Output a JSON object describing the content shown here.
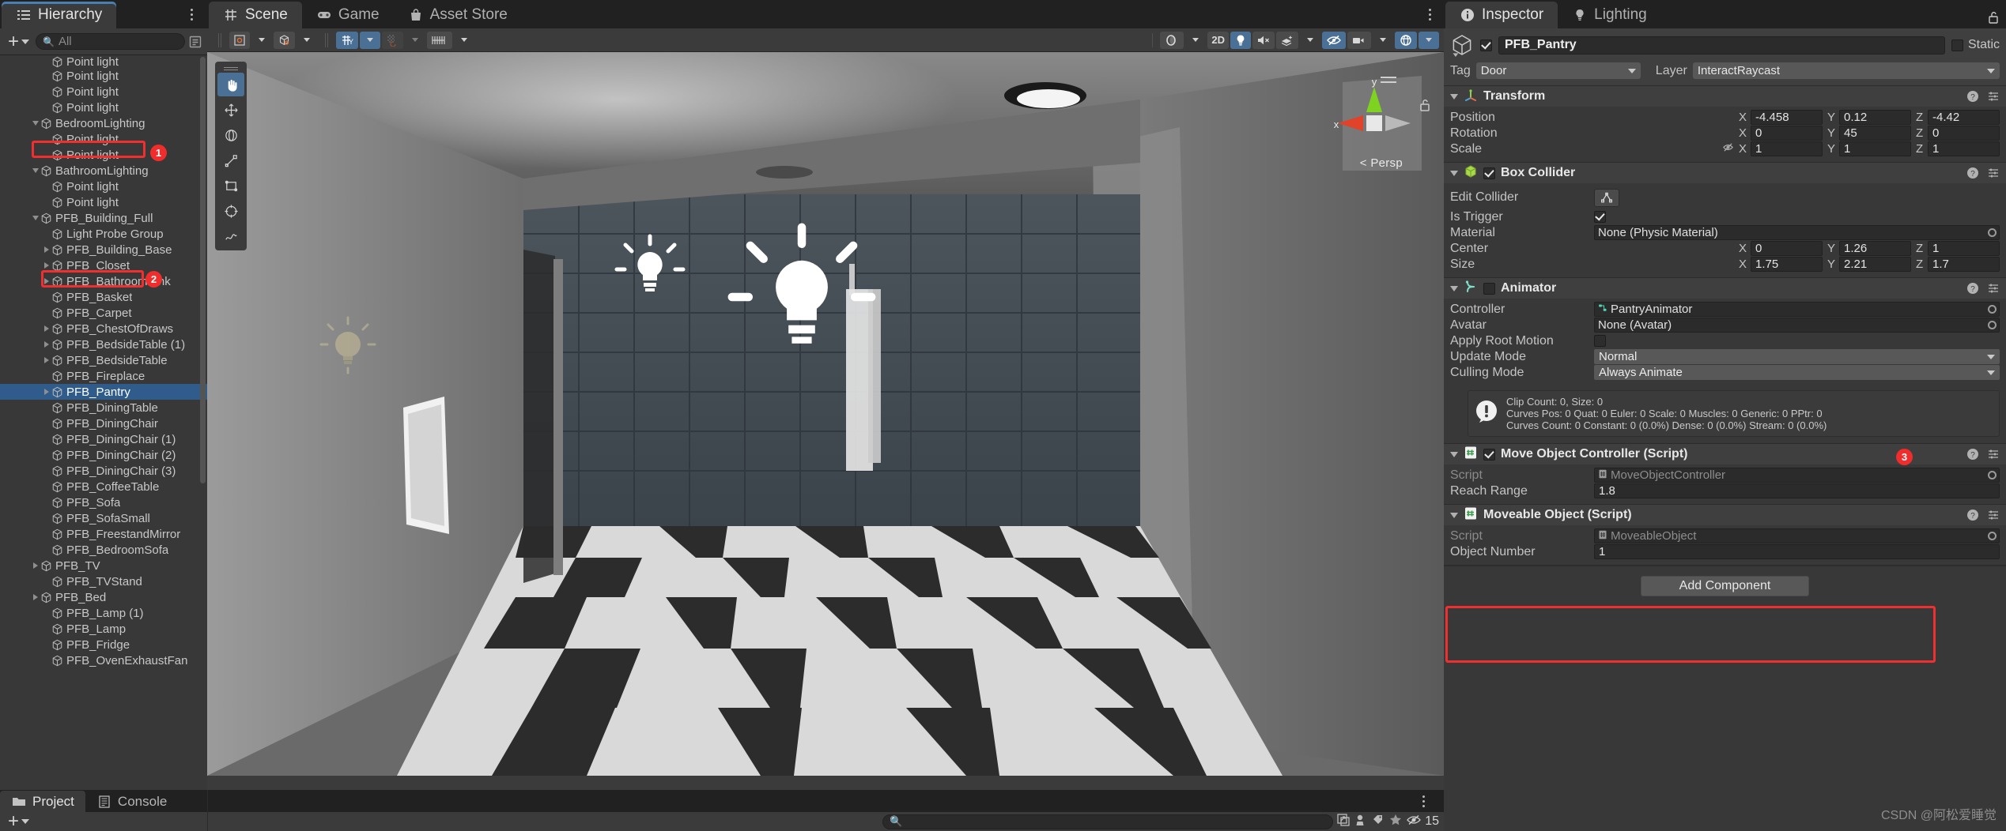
{
  "hierarchy": {
    "tab_label": "Hierarchy",
    "search_placeholder": "All",
    "items": [
      {
        "label": "Point light",
        "depth": 3,
        "arrow": "none",
        "partial": true
      },
      {
        "label": "Point light",
        "depth": 3,
        "arrow": "none"
      },
      {
        "label": "Point light",
        "depth": 3,
        "arrow": "none"
      },
      {
        "label": "Point light",
        "depth": 3,
        "arrow": "none"
      },
      {
        "label": "BedroomLighting",
        "depth": 2,
        "arrow": "open"
      },
      {
        "label": "Point light",
        "depth": 3,
        "arrow": "none"
      },
      {
        "label": "Point light",
        "depth": 3,
        "arrow": "none"
      },
      {
        "label": "BathroomLighting",
        "depth": 2,
        "arrow": "open"
      },
      {
        "label": "Point light",
        "depth": 3,
        "arrow": "none"
      },
      {
        "label": "Point light",
        "depth": 3,
        "arrow": "none"
      },
      {
        "label": "PFB_Building_Full",
        "depth": 2,
        "arrow": "open",
        "highlight": 1
      },
      {
        "label": "Light Probe Group",
        "depth": 3,
        "arrow": "none"
      },
      {
        "label": "PFB_Building_Base",
        "depth": 3,
        "arrow": "closed"
      },
      {
        "label": "PFB_Closet",
        "depth": 3,
        "arrow": "closed"
      },
      {
        "label": "PFB_BathroomSink",
        "depth": 3,
        "arrow": "closed"
      },
      {
        "label": "PFB_Basket",
        "depth": 3,
        "arrow": "none"
      },
      {
        "label": "PFB_Carpet",
        "depth": 3,
        "arrow": "none"
      },
      {
        "label": "PFB_ChestOfDraws",
        "depth": 3,
        "arrow": "closed"
      },
      {
        "label": "PFB_BedsideTable (1)",
        "depth": 3,
        "arrow": "closed"
      },
      {
        "label": "PFB_BedsideTable",
        "depth": 3,
        "arrow": "closed"
      },
      {
        "label": "PFB_Fireplace",
        "depth": 3,
        "arrow": "none"
      },
      {
        "label": "PFB_Pantry",
        "depth": 3,
        "arrow": "closed",
        "selected": true,
        "highlight": 2
      },
      {
        "label": "PFB_DiningTable",
        "depth": 3,
        "arrow": "none"
      },
      {
        "label": "PFB_DiningChair",
        "depth": 3,
        "arrow": "none"
      },
      {
        "label": "PFB_DiningChair (1)",
        "depth": 3,
        "arrow": "none"
      },
      {
        "label": "PFB_DiningChair (2)",
        "depth": 3,
        "arrow": "none"
      },
      {
        "label": "PFB_DiningChair (3)",
        "depth": 3,
        "arrow": "none"
      },
      {
        "label": "PFB_CoffeeTable",
        "depth": 3,
        "arrow": "none"
      },
      {
        "label": "PFB_Sofa",
        "depth": 3,
        "arrow": "none"
      },
      {
        "label": "PFB_SofaSmall",
        "depth": 3,
        "arrow": "none"
      },
      {
        "label": "PFB_FreestandMirror",
        "depth": 3,
        "arrow": "none"
      },
      {
        "label": "PFB_BedroomSofa",
        "depth": 3,
        "arrow": "none"
      },
      {
        "label": "PFB_TV",
        "depth": 2,
        "arrow": "closed"
      },
      {
        "label": "PFB_TVStand",
        "depth": 3,
        "arrow": "none"
      },
      {
        "label": "PFB_Bed",
        "depth": 2,
        "arrow": "closed"
      },
      {
        "label": "PFB_Lamp (1)",
        "depth": 3,
        "arrow": "none"
      },
      {
        "label": "PFB_Lamp",
        "depth": 3,
        "arrow": "none"
      },
      {
        "label": "PFB_Fridge",
        "depth": 3,
        "arrow": "none"
      },
      {
        "label": "PFB_OvenExhaustFan",
        "depth": 3,
        "arrow": "none"
      }
    ]
  },
  "scene": {
    "tabs": [
      {
        "label": "Scene",
        "icon": "grid-icon",
        "active": true
      },
      {
        "label": "Game",
        "icon": "gamepad-icon",
        "active": false
      },
      {
        "label": "Asset Store",
        "icon": "store-bag-icon",
        "active": false
      }
    ],
    "toolbar": {
      "pivot_mode": "center-pivot-icon",
      "handle_space": "global-local-icon",
      "grid_snap": "grid-snap-icon",
      "snap_increment": "snap-increment-icon",
      "layout_icon": "layers-icon",
      "shading_mode": "shaded",
      "twod_label": "2D",
      "lighting_toggle": "lightbulb-icon",
      "audio_toggle": "audio-mute-icon",
      "fx_toggle": "effects-icon",
      "visibility_toggle": "eye-off-icon",
      "camera_toggle": "camera-icon",
      "gizmos_toggle": "gizmos-icon"
    },
    "gizmo": {
      "persp_label": "Persp",
      "axis_x": "x",
      "axis_y": "y"
    },
    "tools": [
      {
        "name": "hand-tool",
        "active": true
      },
      {
        "name": "move-tool",
        "active": false
      },
      {
        "name": "rotate-tool",
        "active": false
      },
      {
        "name": "scale-tool",
        "active": false
      },
      {
        "name": "rect-tool",
        "active": false
      },
      {
        "name": "transform-tool",
        "active": false
      },
      {
        "name": "custom-tool",
        "active": false
      }
    ]
  },
  "inspector": {
    "tabs": [
      {
        "label": "Inspector",
        "icon": "info-icon",
        "active": true
      },
      {
        "label": "Lighting",
        "icon": "lightbulb-icon",
        "active": false
      }
    ],
    "object": {
      "enabled": true,
      "name": "PFB_Pantry",
      "static_label": "Static",
      "static_checked": false,
      "tag_label": "Tag",
      "tag_value": "Door",
      "layer_label": "Layer",
      "layer_value": "InteractRaycast"
    },
    "components": [
      {
        "title": "Transform",
        "icon": "transform-icon",
        "has_checkbox": false,
        "rows": [
          {
            "label": "Position",
            "type": "vector3",
            "x": "-4.458",
            "y": "0.12",
            "z": "-4.42"
          },
          {
            "label": "Rotation",
            "type": "vector3",
            "x": "0",
            "y": "45",
            "z": "0"
          },
          {
            "label": "Scale",
            "type": "vector3",
            "x": "1",
            "y": "1",
            "z": "1",
            "link_icon": "constrain-proportions-off-icon"
          }
        ]
      },
      {
        "title": "Box Collider",
        "icon": "box-collider-icon",
        "has_checkbox": true,
        "checked": true,
        "rows": [
          {
            "label": "Edit Collider",
            "type": "button",
            "button_icon": "edit-collider-icon"
          },
          {
            "label": "Is Trigger",
            "type": "checkbox",
            "checked": true
          },
          {
            "label": "Material",
            "type": "object",
            "value": "None (Physic Material)"
          },
          {
            "label": "Center",
            "type": "vector3",
            "x": "0",
            "y": "1.26",
            "z": "1"
          },
          {
            "label": "Size",
            "type": "vector3",
            "x": "1.75",
            "y": "2.21",
            "z": "1.7"
          }
        ]
      },
      {
        "title": "Animator",
        "icon": "animator-icon",
        "has_checkbox": true,
        "checked": false,
        "rows": [
          {
            "label": "Controller",
            "type": "object",
            "value": "PantryAnimator",
            "value_icon": "animator-controller-icon"
          },
          {
            "label": "Avatar",
            "type": "object",
            "value": "None (Avatar)"
          },
          {
            "label": "Apply Root Motion",
            "type": "checkbox",
            "checked": false
          },
          {
            "label": "Update Mode",
            "type": "enum",
            "value": "Normal"
          },
          {
            "label": "Culling Mode",
            "type": "enum",
            "value": "Always Animate"
          }
        ],
        "info": {
          "icon": "warning-icon",
          "line1": "Clip Count: 0, Size: 0",
          "line2": "Curves Pos: 0 Quat: 0 Euler: 0 Scale: 0 Muscles: 0 Generic: 0 PPtr: 0",
          "line3": "Curves Count: 0 Constant: 0 (0.0%) Dense: 0 (0.0%) Stream: 0 (0.0%)"
        }
      },
      {
        "title": "Move Object Controller (Script)",
        "icon": "script-icon",
        "has_checkbox": true,
        "checked": true,
        "highlight": 3,
        "rows": [
          {
            "label": "Script",
            "type": "object",
            "value": "MoveObjectController",
            "dimmed": true,
            "value_icon": "script-icon"
          },
          {
            "label": "Reach Range",
            "type": "text",
            "value": "1.8"
          }
        ]
      },
      {
        "title": "Moveable Object (Script)",
        "icon": "script-icon",
        "has_checkbox": false,
        "rows": [
          {
            "label": "Script",
            "type": "object",
            "value": "MoveableObject",
            "dimmed": true,
            "value_icon": "script-icon"
          },
          {
            "label": "Object Number",
            "type": "text",
            "value": "1"
          }
        ]
      }
    ],
    "add_component_label": "Add Component",
    "watermark": "CSDN @阿松爱睡觉"
  },
  "project_bar": {
    "tabs": [
      {
        "label": "Project",
        "icon": "folder-icon",
        "active": true
      },
      {
        "label": "Console",
        "icon": "console-icon",
        "active": false
      }
    ],
    "search_placeholder": "",
    "visibility_count": "15"
  }
}
